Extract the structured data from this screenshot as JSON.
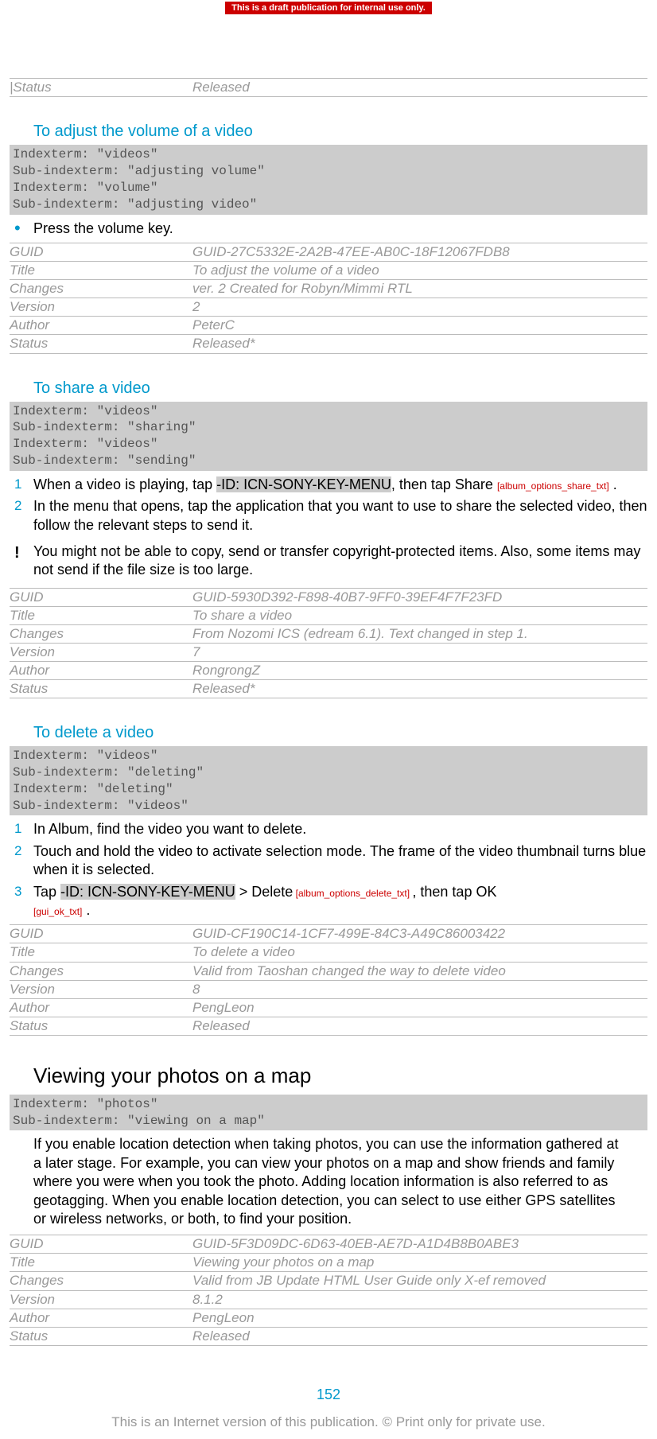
{
  "banner": "This is a draft publication for internal use only.",
  "top_meta": {
    "status_label": "Status",
    "status_value": "Released",
    "divider": "|"
  },
  "sec1": {
    "heading": "To adjust the volume of a video",
    "idx": "Indexterm: \"videos\"\nSub-indexterm: \"adjusting volume\"\nIndexterm: \"volume\"\nSub-indexterm: \"adjusting video\"",
    "step": "Press the volume key.",
    "meta": {
      "guid": "GUID-27C5332E-2A2B-47EE-AB0C-18F12067FDB8",
      "title": "To adjust the volume of a video",
      "changes": "ver. 2 Created for Robyn/Mimmi RTL",
      "version": "2",
      "author": "PeterC",
      "status": "Released*"
    }
  },
  "sec2": {
    "heading": "To share a video",
    "idx": "Indexterm: \"videos\"\nSub-indexterm: \"sharing\"\nIndexterm: \"videos\"\nSub-indexterm: \"sending\"",
    "step1a": "When a video is playing, tap ",
    "key": "-ID: ICN-SONY-KEY-MENU",
    "step1b": ", then tap ",
    "share": "Share",
    "ref1": "[album_options_share_txt]",
    "period": " .",
    "step2": "In the menu that opens, tap the application that you want to use to share the selected video, then follow the relevant steps to send it.",
    "note": "You might not be able to copy, send or transfer copyright-protected items. Also, some items may not send if the file size is too large.",
    "meta": {
      "guid": "GUID-5930D392-F898-40B7-9FF0-39EF4F7F23FD",
      "title": "To share a video",
      "changes": "From Nozomi ICS (edream 6.1). Text changed in step 1.",
      "version": "7",
      "author": "RongrongZ",
      "status": "Released*"
    }
  },
  "sec3": {
    "heading": "To delete a video",
    "idx": "Indexterm: \"videos\"\nSub-indexterm: \"deleting\"\nIndexterm: \"deleting\"\nSub-indexterm: \"videos\"",
    "step1": "In Album, find the video you want to delete.",
    "step2": "Touch and hold the video to activate selection mode. The frame of the video thumbnail turns blue when it is selected.",
    "step3a": "Tap ",
    "key": "-ID: ICN-SONY-KEY-MENU",
    "gt": " > ",
    "delete": "Delete",
    "ref1": " [album_options_delete_txt] ",
    "step3b": ", then tap ",
    "ok": "OK",
    "ref2": "[gui_ok_txt]",
    "period": " .",
    "meta": {
      "guid": "GUID-CF190C14-1CF7-499E-84C3-A49C86003422",
      "title": "To delete a video",
      "changes": "Valid from Taoshan changed the way to delete video",
      "version": "8",
      "author": "PengLeon",
      "status": "Released"
    }
  },
  "sec4": {
    "heading": "Viewing your photos on a map",
    "idx": "Indexterm: \"photos\"\nSub-indexterm: \"viewing on a map\"",
    "para": "If you enable location detection when taking photos, you can use the information gathered at a later stage. For example, you can view your photos on a map and show friends and family where you were when you took the photo. Adding location information is also referred to as geotagging. When you enable location detection, you can select to use either GPS satellites or wireless networks, or both, to find your position.",
    "meta": {
      "guid": "GUID-5F3D09DC-6D63-40EB-AE7D-A1D4B8B0ABE3",
      "title": "Viewing your photos on a map",
      "changes": "Valid from JB Update HTML User Guide only X-ef removed",
      "version": "8.1.2",
      "author": "PengLeon",
      "status": "Released"
    }
  },
  "labels": {
    "guid": "GUID",
    "title": "Title",
    "changes": "Changes",
    "version": "Version",
    "author": "Author",
    "status": "Status"
  },
  "page_num": "152",
  "footer": "This is an Internet version of this publication. © Print only for private use."
}
